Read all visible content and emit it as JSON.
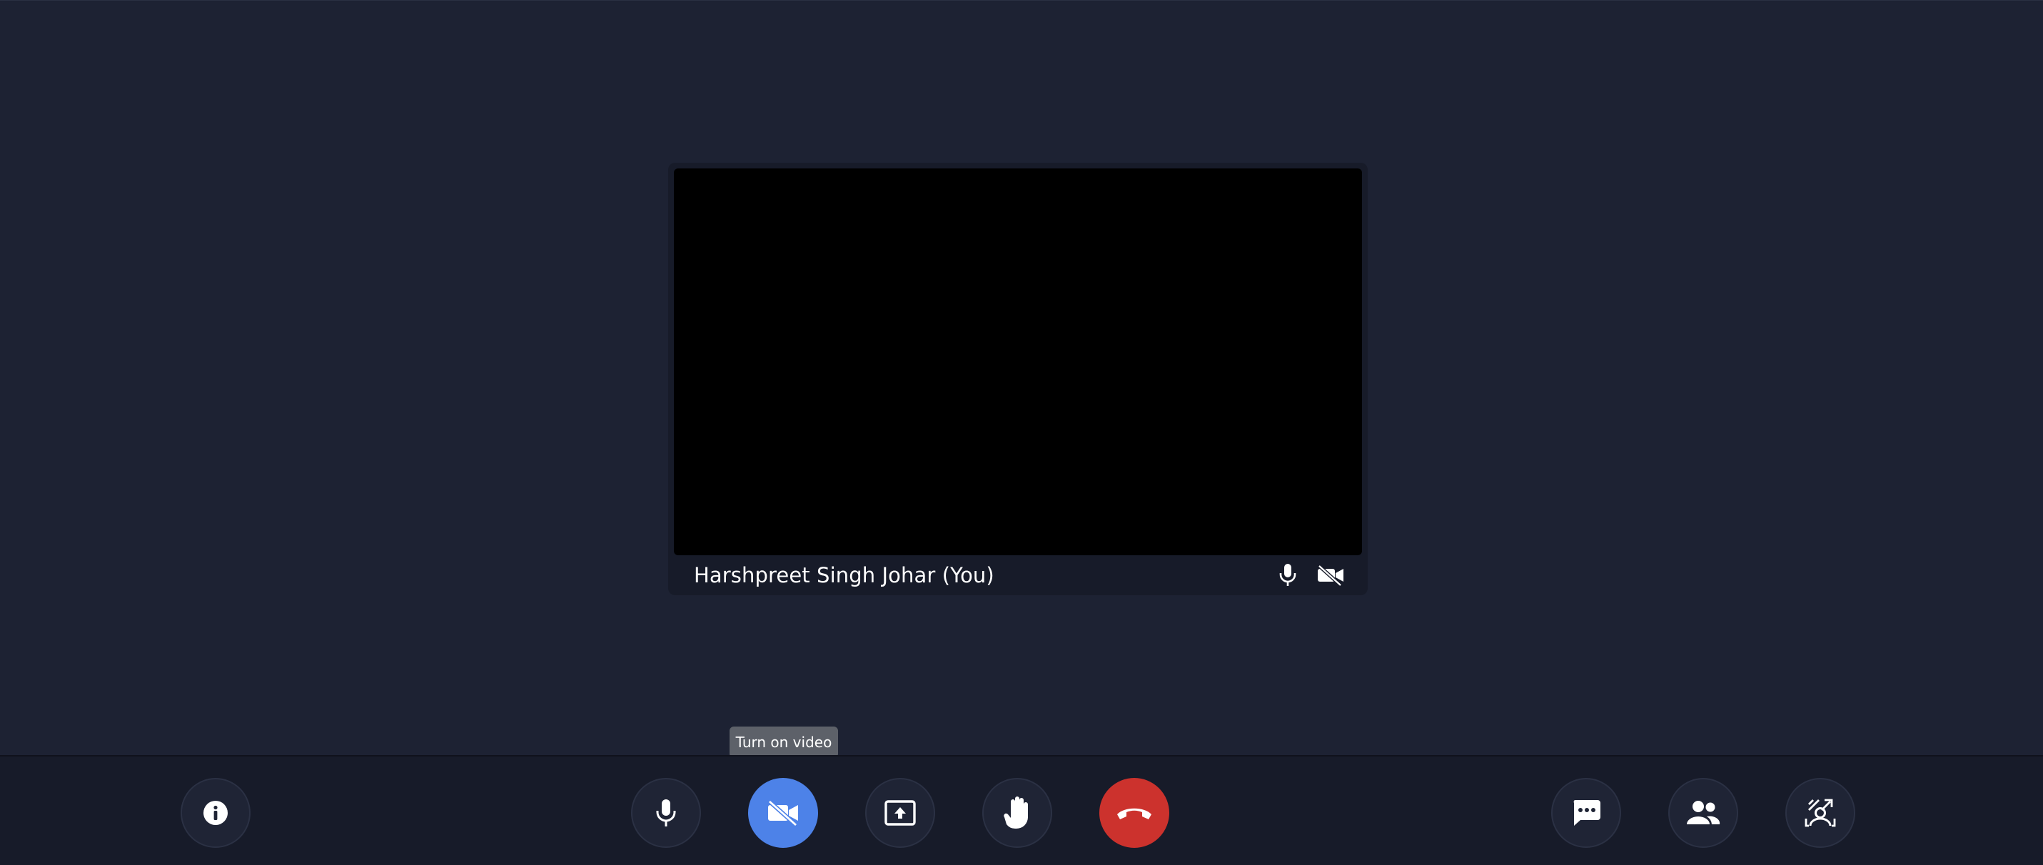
{
  "participant": {
    "name": "Harshpreet Singh Johar (You)",
    "mic_icon": "mic-icon",
    "video_icon": "video-off-icon"
  },
  "tooltip": {
    "text": "Turn on video"
  },
  "toolbar": {
    "buttons": [
      {
        "name": "meeting-info",
        "icon": "info-icon"
      },
      {
        "name": "microphone",
        "icon": "mic-icon"
      },
      {
        "name": "video-toggle",
        "icon": "video-off-icon",
        "state": "off"
      },
      {
        "name": "share-screen",
        "icon": "present-screen-icon"
      },
      {
        "name": "raise-hand",
        "icon": "hand-icon"
      },
      {
        "name": "leave-call",
        "icon": "phone-hangup-icon"
      },
      {
        "name": "chat",
        "icon": "chat-icon"
      },
      {
        "name": "participants",
        "icon": "people-icon"
      },
      {
        "name": "background-effects",
        "icon": "background-effects-icon"
      }
    ]
  },
  "colors": {
    "stage_background": "#1d2233",
    "toolbar_background": "#171b29",
    "video_off_accent": "#4d82e8",
    "hangup_red": "#cc322d",
    "tooltip_background": "#5d6169"
  }
}
